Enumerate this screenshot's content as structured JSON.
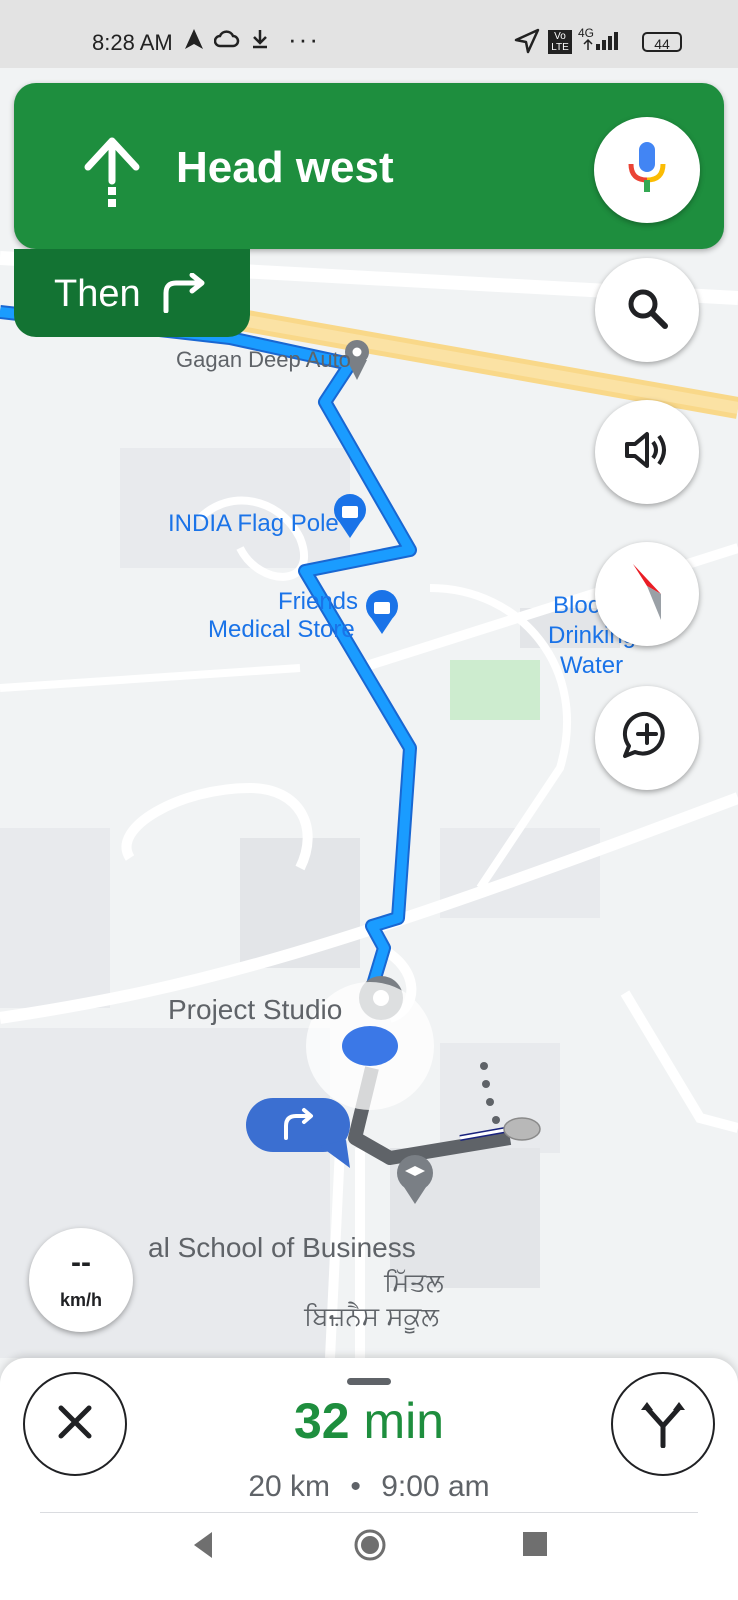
{
  "status_bar": {
    "time": "8:28 AM",
    "network": "4G",
    "volte": "Vo LTE",
    "battery": "44",
    "dots": "···"
  },
  "map": {
    "labels": {
      "gagan": "Gagan Deep Auto",
      "flag": "INDIA Flag Pole",
      "friends1": "Friends",
      "friends2": "Medical Store",
      "block1": "Block",
      "block2": "Drinking",
      "block3": "Water",
      "project": "Project Studio",
      "school": "al School of Business",
      "punjabi1": "ਮਿੱਤਲ",
      "punjabi2": "ਬਿਜ਼ਨੈਸ ਸਕੂਲ"
    },
    "route_color": "#1a9cff",
    "walk_color": "#5f6368"
  },
  "navigation": {
    "direction": "Head west",
    "then_label": "Then",
    "banner_color": "#1e8e3e",
    "then_color": "#137333"
  },
  "controls": {
    "icons": [
      "mic-icon",
      "search-icon",
      "volume-icon",
      "compass-icon",
      "add-report-icon"
    ]
  },
  "speedometer": {
    "value": "--",
    "unit": "km/h"
  },
  "trip": {
    "duration_value": "32",
    "duration_unit": "min",
    "distance": "20 km",
    "separator": "•",
    "arrival": "9:00 am"
  },
  "system_nav": {
    "icons": [
      "back-icon",
      "home-icon",
      "recents-icon"
    ]
  }
}
